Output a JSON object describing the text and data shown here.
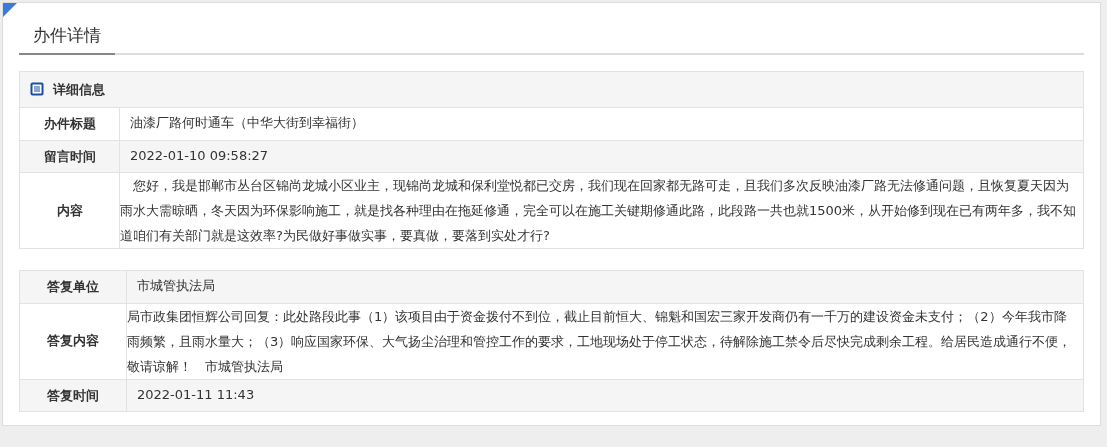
{
  "tabs": [
    {
      "label": "办件详情",
      "selected": true
    }
  ],
  "sections": [
    {
      "header": "详细信息",
      "rows": [
        {
          "label": "办件标题",
          "value": "油漆厂路何时通车（中华大街到幸福街）",
          "kind": "line"
        },
        {
          "label": "留言时间",
          "value": "2022-01-10 09:58:27",
          "kind": "line"
        },
        {
          "label": "内容",
          "value": "您好，我是邯郸市丛台区锦尚龙城小区业主，现锦尚龙城和保利堂悦都已交房，我们现在回家都无路可走，且我们多次反映油漆厂路无法修通问题，且恢复夏天因为雨水大需晾晒，冬天因为环保影响施工，就是找各种理由在拖延修通，完全可以在施工关键期修通此路，此段路一共也就1500米，从开始修到现在已有两年多，我不知道咱们有关部门就是这效率?为民做好事做实事，要真做，要落到实处才行?",
          "kind": "indented"
        }
      ]
    },
    {
      "rows": [
        {
          "label": "答复单位",
          "value": "市城管执法局",
          "kind": "line"
        },
        {
          "label": "答复内容",
          "value": "局市政集团恒辉公司回复：此处路段此事（1）该项目由于资金拨付不到位，截止目前恒大、锦魁和国宏三家开发商仍有一千万的建设资金未支付；（2）今年我市降雨频繁，且雨水量大；（3）响应国家环保、大气扬尘治理和管控工作的要求，工地现场处于停工状态，待解除施工禁令后尽快完成剩余工程。给居民造成通行不便，敬请谅解！　市城管执法局",
          "kind": "flush"
        },
        {
          "label": "答复时间",
          "value": "2022-01-11 11:43",
          "kind": "line"
        }
      ]
    }
  ]
}
